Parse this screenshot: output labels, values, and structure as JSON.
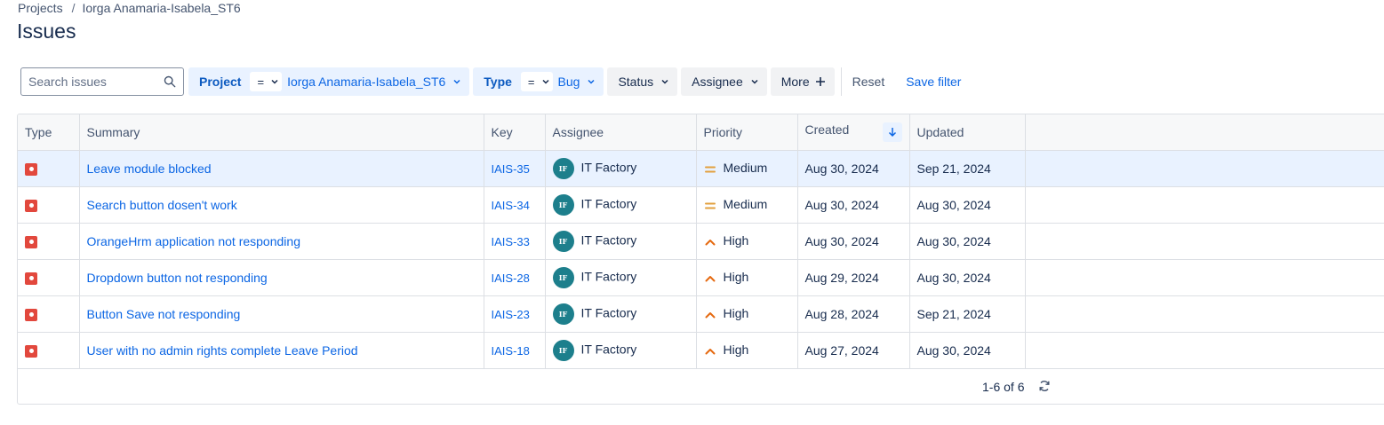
{
  "breadcrumb": {
    "root": "Projects",
    "separator": "/",
    "project": "Iorga Anamaria-Isabela_ST6"
  },
  "page_title": "Issues",
  "filters": {
    "search_placeholder": "Search issues",
    "project": {
      "label": "Project",
      "operator": "=",
      "value": "Iorga Anamaria-Isabela_ST6"
    },
    "type": {
      "label": "Type",
      "operator": "=",
      "value": "Bug"
    },
    "status": "Status",
    "assignee": "Assignee",
    "more": "More",
    "reset": "Reset",
    "save_filter": "Save filter"
  },
  "table": {
    "columns": [
      "Type",
      "Summary",
      "Key",
      "Assignee",
      "Priority",
      "Created",
      "Updated"
    ],
    "rows": [
      {
        "type": "bug",
        "summary": "Leave module blocked",
        "key": "IAIS-35",
        "assignee_initials": "IF",
        "assignee": "IT Factory",
        "priority": "Medium",
        "created": "Aug 30, 2024",
        "updated": "Sep 21, 2024"
      },
      {
        "type": "bug",
        "summary": "Search button dosen't work",
        "key": "IAIS-34",
        "assignee_initials": "IF",
        "assignee": "IT Factory",
        "priority": "Medium",
        "created": "Aug 30, 2024",
        "updated": "Aug 30, 2024"
      },
      {
        "type": "bug",
        "summary": "OrangeHrm application not responding",
        "key": "IAIS-33",
        "assignee_initials": "IF",
        "assignee": "IT Factory",
        "priority": "High",
        "created": "Aug 30, 2024",
        "updated": "Aug 30, 2024"
      },
      {
        "type": "bug",
        "summary": "Dropdown button not responding",
        "key": "IAIS-28",
        "assignee_initials": "IF",
        "assignee": "IT Factory",
        "priority": "High",
        "created": "Aug 29, 2024",
        "updated": "Aug 30, 2024"
      },
      {
        "type": "bug",
        "summary": "Button Save not responding",
        "key": "IAIS-23",
        "assignee_initials": "IF",
        "assignee": "IT Factory",
        "priority": "High",
        "created": "Aug 28, 2024",
        "updated": "Sep 21, 2024"
      },
      {
        "type": "bug",
        "summary": "User with no admin rights complete Leave Period",
        "key": "IAIS-18",
        "assignee_initials": "IF",
        "assignee": "IT Factory",
        "priority": "High",
        "created": "Aug 27, 2024",
        "updated": "Aug 30, 2024"
      }
    ],
    "pagination": "1-6 of 6"
  },
  "colors": {
    "accent": "#0c66e4",
    "bug": "#e2483d",
    "medium": "#e2a03f",
    "high": "#e56910",
    "avatar": "#1d7f8c"
  }
}
